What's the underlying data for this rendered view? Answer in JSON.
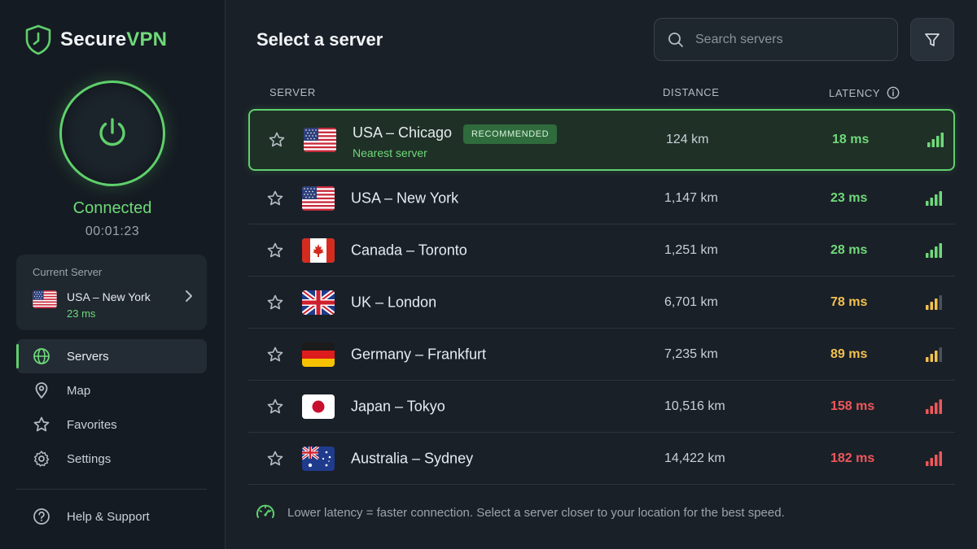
{
  "brand": {
    "name_primary": "Secure",
    "name_accent": "VPN"
  },
  "colors": {
    "accent": "#5fd06c",
    "good": "#6fd97a",
    "medium": "#f2c14e",
    "poor": "#f0575a"
  },
  "connection": {
    "status": "Connected",
    "timer": "00:01:23"
  },
  "current_server": {
    "title": "Current Server",
    "name": "USA – New York",
    "latency": "23 ms",
    "flag": "us-flag"
  },
  "nav": {
    "items": [
      {
        "label": "Servers",
        "icon": "globe-icon",
        "active": true
      },
      {
        "label": "Map",
        "icon": "map-pin-icon",
        "active": false
      },
      {
        "label": "Favorites",
        "icon": "star-icon",
        "active": false
      },
      {
        "label": "Settings",
        "icon": "gear-icon",
        "active": false
      }
    ],
    "help": "Help & Support"
  },
  "main": {
    "title": "Select a server",
    "search_placeholder": "Search servers",
    "columns": {
      "server": "SERVER",
      "distance": "DISTANCE",
      "latency": "LATENCY"
    }
  },
  "servers": [
    {
      "name": "USA – Chicago",
      "badge": "RECOMMENDED",
      "sub": "Nearest server",
      "distance": "124 km",
      "latency": "18 ms",
      "quality": "good",
      "signal_bars": 4,
      "flag": "us-flag"
    },
    {
      "name": "USA – New York",
      "distance": "1,147 km",
      "latency": "23 ms",
      "quality": "good",
      "signal_bars": 4,
      "flag": "us-flag"
    },
    {
      "name": "Canada – Toronto",
      "distance": "1,251 km",
      "latency": "28 ms",
      "quality": "good",
      "signal_bars": 4,
      "flag": "ca-flag"
    },
    {
      "name": "UK – London",
      "distance": "6,701 km",
      "latency": "78 ms",
      "quality": "medium",
      "signal_bars": 3,
      "flag": "uk-flag"
    },
    {
      "name": "Germany – Frankfurt",
      "distance": "7,235 km",
      "latency": "89 ms",
      "quality": "medium",
      "signal_bars": 3,
      "flag": "de-flag"
    },
    {
      "name": "Japan – Tokyo",
      "distance": "10,516 km",
      "latency": "158 ms",
      "quality": "poor",
      "signal_bars": 4,
      "flag": "jp-flag"
    },
    {
      "name": "Australia – Sydney",
      "distance": "14,422 km",
      "latency": "182 ms",
      "quality": "poor",
      "signal_bars": 4,
      "flag": "au-flag"
    }
  ],
  "tip": "Lower latency = faster connection. Select a server closer to your location for the best speed."
}
